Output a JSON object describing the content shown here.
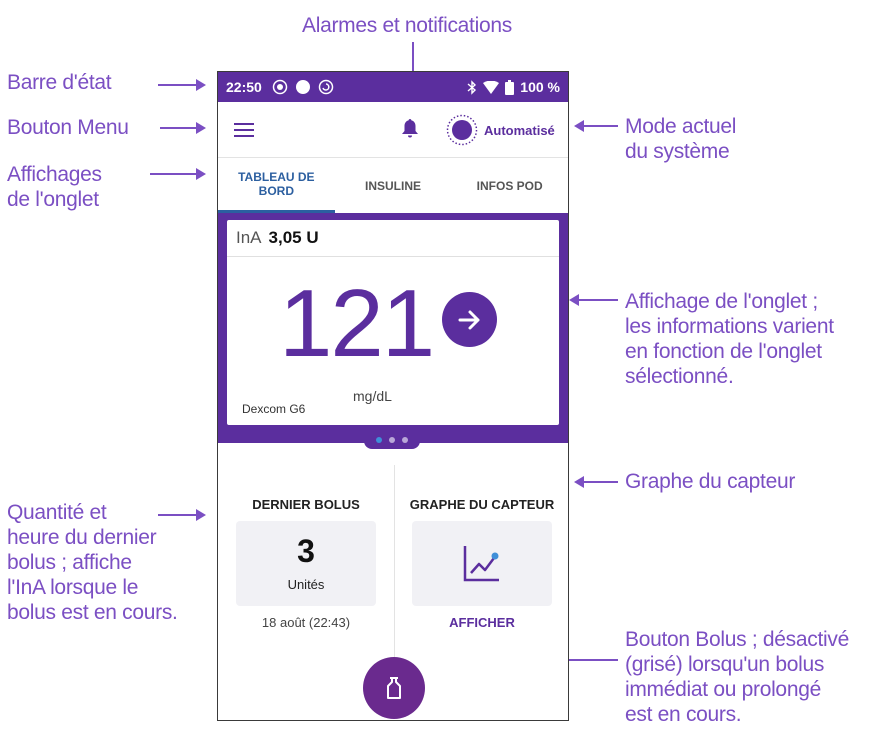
{
  "callouts": {
    "alarms": "Alarmes et notifications",
    "status_bar": "Barre d'état",
    "menu_button": "Bouton Menu",
    "tab_display_line1": "Affichages",
    "tab_display_line2": "de l'onglet",
    "mode_line1": "Mode actuel",
    "mode_line2": "du système",
    "tab_content_line1": "Affichage de l'onglet ;",
    "tab_content_line2": "les informations varient",
    "tab_content_line3": "en fonction de l'onglet",
    "tab_content_line4": "sélectionné.",
    "sensor_graph": "Graphe du capteur",
    "last_bolus_line1": "Quantité et",
    "last_bolus_line2": "heure du dernier",
    "last_bolus_line3": "bolus ; affiche",
    "last_bolus_line4": "l'InA lorsque le",
    "last_bolus_line5": "bolus est en cours.",
    "bolus_button_line1": "Bouton Bolus ; désactivé",
    "bolus_button_line2": "(grisé) lorsqu'un bolus",
    "bolus_button_line3": "immédiat ou prolongé",
    "bolus_button_line4": "est en cours."
  },
  "status": {
    "time": "22:50",
    "battery": "100 %"
  },
  "appbar": {
    "mode_label": "Automatisé"
  },
  "tabs": [
    {
      "label": "TABLEAU DE BORD"
    },
    {
      "label": "INSULINE"
    },
    {
      "label": "INFOS POD"
    }
  ],
  "dashboard": {
    "iob_label": "InA",
    "iob_value": "3,05 U",
    "glucose": "121",
    "glucose_unit": "mg/dL",
    "cgm_name": "Dexcom G6",
    "page_indicator": {
      "count": 3,
      "active": 1
    }
  },
  "last_bolus": {
    "header": "DERNIER BOLUS",
    "amount": "3",
    "unit": "Unités",
    "time": "18 août (22:43)"
  },
  "sensor_graph": {
    "header": "GRAPHE DU CAPTEUR",
    "link": "AFFICHER"
  },
  "icons": {
    "menu": "hamburger-icon",
    "bell": "bell-icon",
    "mode": "automated-mode-icon",
    "arrow": "arrow-right-icon",
    "graph": "chart-icon",
    "bolus": "bolus-vial-icon"
  },
  "colors": {
    "accent": "#5b2e9e",
    "callout": "#7b4fc3",
    "tab_active": "#2c5fa0"
  }
}
